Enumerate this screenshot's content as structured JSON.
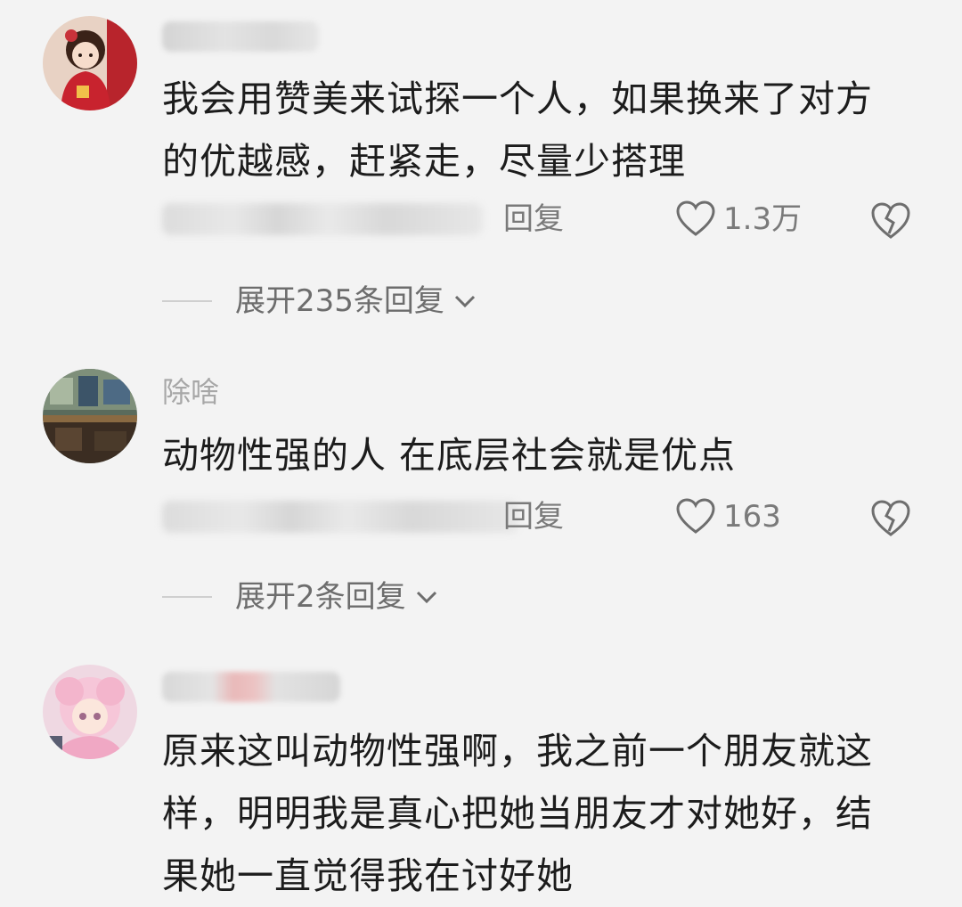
{
  "comments": [
    {
      "username": "",
      "avatar_icon": "girl-avatar-icon",
      "text": "我会用赞美来试探一个人，如果换来了对方的优越感，赶紧走，尽量少搭理",
      "reply_label": "回复",
      "like_count": "1.3万",
      "like_icon": "heart-icon",
      "dislike_icon": "broken-heart-icon",
      "expand_label": "展开235条回复",
      "expand_icon": "chevron-down-icon"
    },
    {
      "username": "除啥",
      "avatar_icon": "room-avatar-icon",
      "text": "动物性强的人  在底层社会就是优点",
      "reply_label": "回复",
      "like_count": "163",
      "like_icon": "heart-icon",
      "dislike_icon": "broken-heart-icon",
      "expand_label": "展开2条回复",
      "expand_icon": "chevron-down-icon"
    },
    {
      "username": "",
      "avatar_icon": "anime-avatar-icon",
      "text": "原来这叫动物性强啊，我之前一个朋友就这样，明明我是真心把她当朋友才对她好，结果她一直觉得我在讨好她"
    }
  ],
  "colors": {
    "background": "#f3f3f3",
    "text": "#1c1c1c",
    "muted": "#7a7a7a"
  }
}
